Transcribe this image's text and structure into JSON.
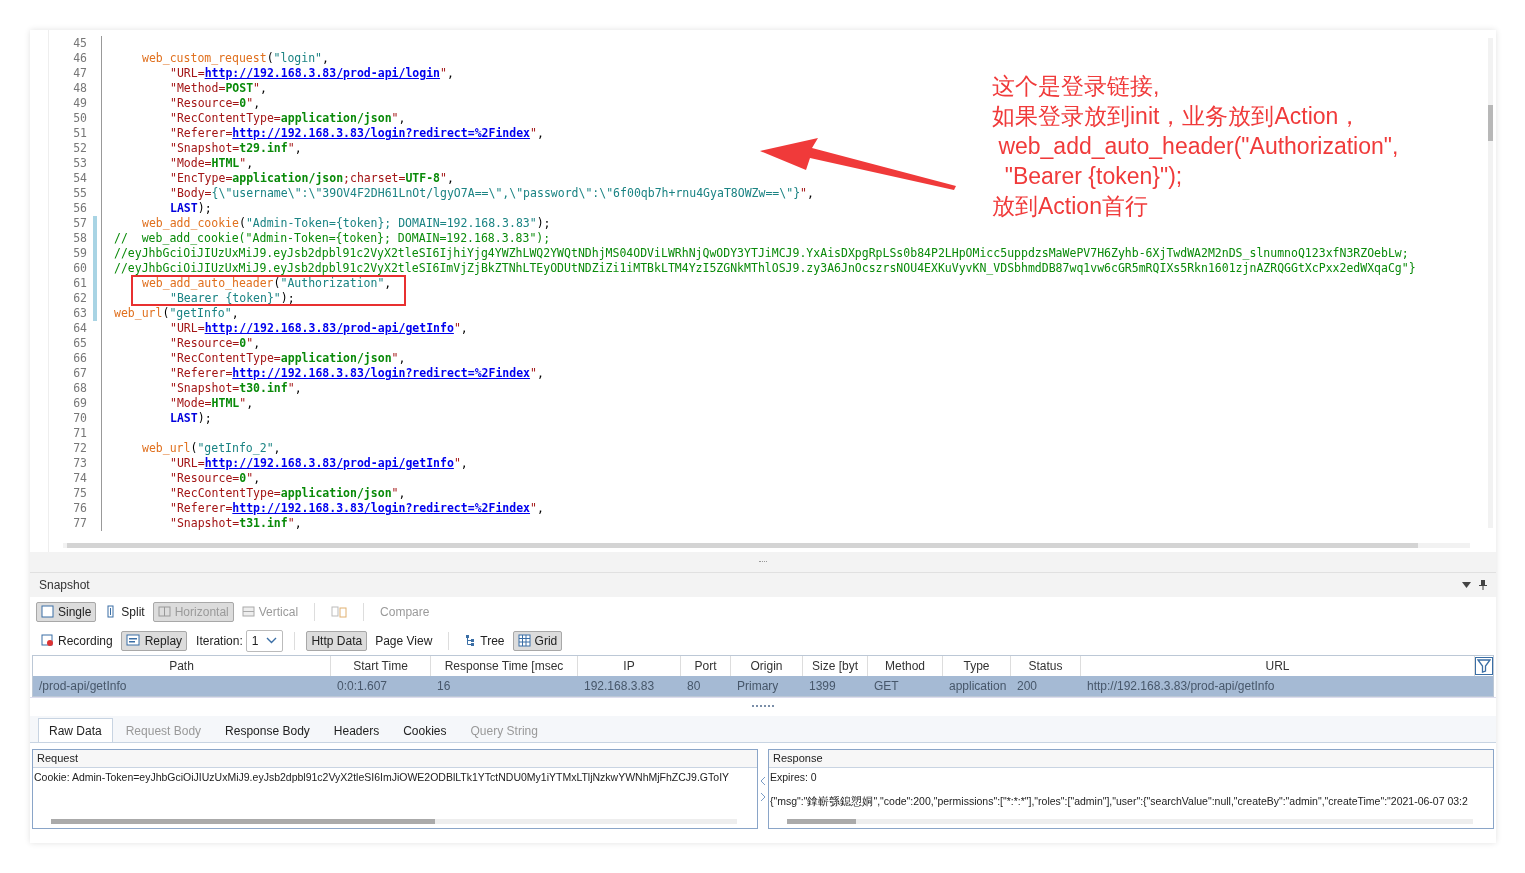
{
  "editor": {
    "lines": [
      {
        "number": "45",
        "changed": false,
        "kind": "blank"
      },
      {
        "number": "46",
        "changed": false,
        "kind": "call",
        "segments": [
          {
            "kind": "fn",
            "text": "web_custom_request"
          },
          {
            "kind": "p",
            "text": "("
          },
          {
            "kind": "str",
            "text": "\"login\""
          },
          {
            "kind": "p",
            "text": ","
          }
        ]
      },
      {
        "number": "47",
        "changed": false,
        "kind": "param",
        "segments": [
          {
            "kind": "key",
            "text": "\"URL="
          },
          {
            "kind": "link",
            "text": "http://192.168.3.83/prod-api/login"
          },
          {
            "kind": "key",
            "text": "\""
          },
          {
            "kind": "p",
            "text": ","
          }
        ]
      },
      {
        "number": "48",
        "changed": false,
        "kind": "param",
        "segments": [
          {
            "kind": "key",
            "text": "\"Method="
          },
          {
            "kind": "val",
            "text": "POST"
          },
          {
            "kind": "key",
            "text": "\""
          },
          {
            "kind": "p",
            "text": ","
          }
        ]
      },
      {
        "number": "49",
        "changed": false,
        "kind": "param",
        "segments": [
          {
            "kind": "key",
            "text": "\"Resource="
          },
          {
            "kind": "val",
            "text": "0"
          },
          {
            "kind": "key",
            "text": "\""
          },
          {
            "kind": "p",
            "text": ","
          }
        ]
      },
      {
        "number": "50",
        "changed": false,
        "kind": "param",
        "segments": [
          {
            "kind": "key",
            "text": "\"RecContentType="
          },
          {
            "kind": "val",
            "text": "application/json"
          },
          {
            "kind": "key",
            "text": "\""
          },
          {
            "kind": "p",
            "text": ","
          }
        ]
      },
      {
        "number": "51",
        "changed": false,
        "kind": "param",
        "segments": [
          {
            "kind": "key",
            "text": "\"Referer="
          },
          {
            "kind": "link",
            "text": "http://192.168.3.83/login?redirect=%2Findex"
          },
          {
            "kind": "key",
            "text": "\""
          },
          {
            "kind": "p",
            "text": ","
          }
        ]
      },
      {
        "number": "52",
        "changed": false,
        "kind": "param",
        "segments": [
          {
            "kind": "key",
            "text": "\"Snapshot="
          },
          {
            "kind": "val",
            "text": "t29.inf"
          },
          {
            "kind": "key",
            "text": "\""
          },
          {
            "kind": "p",
            "text": ","
          }
        ]
      },
      {
        "number": "53",
        "changed": false,
        "kind": "param",
        "segments": [
          {
            "kind": "key",
            "text": "\"Mode="
          },
          {
            "kind": "val",
            "text": "HTML"
          },
          {
            "kind": "key",
            "text": "\""
          },
          {
            "kind": "p",
            "text": ","
          }
        ]
      },
      {
        "number": "54",
        "changed": false,
        "kind": "param",
        "segments": [
          {
            "kind": "key",
            "text": "\"EncType="
          },
          {
            "kind": "val",
            "text": "application/json"
          },
          {
            "kind": "key",
            "text": ";charset="
          },
          {
            "kind": "val",
            "text": "UTF-8"
          },
          {
            "kind": "key",
            "text": "\""
          },
          {
            "kind": "p",
            "text": ","
          }
        ]
      },
      {
        "number": "55",
        "changed": false,
        "kind": "param",
        "segments": [
          {
            "kind": "key",
            "text": "\"Body="
          },
          {
            "kind": "str",
            "text": "{\\\"username\\\":\\\"39OV4F2DH61LnOt/lgyO7A==\\\",\\\"password\\\":\\\"6f00qb7h+rnu4GyaT8OWZw==\\\"}"
          },
          {
            "kind": "key",
            "text": "\""
          },
          {
            "kind": "p",
            "text": ","
          }
        ]
      },
      {
        "number": "56",
        "changed": false,
        "kind": "param",
        "segments": [
          {
            "kind": "kw",
            "text": "LAST"
          },
          {
            "kind": "p",
            "text": ");"
          }
        ]
      },
      {
        "number": "57",
        "changed": true,
        "kind": "call",
        "segments": [
          {
            "kind": "fn",
            "text": "web_add_cookie"
          },
          {
            "kind": "p",
            "text": "("
          },
          {
            "kind": "str",
            "text": "\"Admin-Token={token}; DOMAIN=192.168.3.83\""
          },
          {
            "kind": "p",
            "text": ");"
          }
        ]
      },
      {
        "number": "58",
        "changed": true,
        "kind": "flush",
        "segments": [
          {
            "kind": "cmt",
            "text": "//  web_add_cookie(\"Admin-Token={token}; DOMAIN=192.168.3.83\");"
          }
        ]
      },
      {
        "number": "59",
        "changed": true,
        "kind": "flush",
        "segments": [
          {
            "kind": "cmt",
            "text": "//eyJhbGciOiJIUzUxMiJ9.eyJsb2dpbl91c2VyX2tleSI6IjhiYjg4YWZhLWQ2YWQtNDhjMS04ODViLWRhNjQwODY3YTJiMCJ9.YxAisDXpgRpLSs0b84P2LHpOMicc5uppdzsMaWePV7H6Zyhb-6XjTwdWA2M2nDS_slnumnoQ123xfN3RZOebLw;"
          }
        ]
      },
      {
        "number": "60",
        "changed": true,
        "kind": "flush",
        "segments": [
          {
            "kind": "cmt",
            "text": "//eyJhbGciOiJIUzUxMiJ9.eyJsb2dpbl91c2VyX2tleSI6ImVjZjBkZTNhLTEyODUtNDZiZi1iMTBkLTM4YzI5ZGNkMThlOSJ9.zy3A6JnOcszrsNOU4EXKuVyvKN_VDSbhmdDB87wq1vw6cGR5mRQIXs5Rkn1601zjnAZRQGGtXcPxx2edWXqaCg\"}"
          }
        ]
      },
      {
        "number": "61",
        "changed": true,
        "kind": "call",
        "segments": [
          {
            "kind": "fn",
            "text": "web_add_auto_header"
          },
          {
            "kind": "p",
            "text": "("
          },
          {
            "kind": "str",
            "text": "\"Authorization\""
          },
          {
            "kind": "p",
            "text": ","
          }
        ]
      },
      {
        "number": "62",
        "changed": true,
        "kind": "param",
        "segments": [
          {
            "kind": "str",
            "text": "\"Bearer {token}\""
          },
          {
            "kind": "p",
            "text": ");"
          }
        ]
      },
      {
        "number": "63",
        "changed": true,
        "kind": "flush",
        "segments": [
          {
            "kind": "fn",
            "text": "web_url"
          },
          {
            "kind": "p",
            "text": "("
          },
          {
            "kind": "str",
            "text": "\"getInfo\""
          },
          {
            "kind": "p",
            "text": ","
          }
        ]
      },
      {
        "number": "64",
        "changed": false,
        "kind": "param",
        "segments": [
          {
            "kind": "key",
            "text": "\"URL="
          },
          {
            "kind": "link",
            "text": "http://192.168.3.83/prod-api/getInfo"
          },
          {
            "kind": "key",
            "text": "\""
          },
          {
            "kind": "p",
            "text": ","
          }
        ]
      },
      {
        "number": "65",
        "changed": false,
        "kind": "param",
        "segments": [
          {
            "kind": "key",
            "text": "\"Resource="
          },
          {
            "kind": "val",
            "text": "0"
          },
          {
            "kind": "key",
            "text": "\""
          },
          {
            "kind": "p",
            "text": ","
          }
        ]
      },
      {
        "number": "66",
        "changed": false,
        "kind": "param",
        "segments": [
          {
            "kind": "key",
            "text": "\"RecContentType="
          },
          {
            "kind": "val",
            "text": "application/json"
          },
          {
            "kind": "key",
            "text": "\""
          },
          {
            "kind": "p",
            "text": ","
          }
        ]
      },
      {
        "number": "67",
        "changed": false,
        "kind": "param",
        "segments": [
          {
            "kind": "key",
            "text": "\"Referer="
          },
          {
            "kind": "link",
            "text": "http://192.168.3.83/login?redirect=%2Findex"
          },
          {
            "kind": "key",
            "text": "\""
          },
          {
            "kind": "p",
            "text": ","
          }
        ]
      },
      {
        "number": "68",
        "changed": false,
        "kind": "param",
        "segments": [
          {
            "kind": "key",
            "text": "\"Snapshot="
          },
          {
            "kind": "val",
            "text": "t30.inf"
          },
          {
            "kind": "key",
            "text": "\""
          },
          {
            "kind": "p",
            "text": ","
          }
        ]
      },
      {
        "number": "69",
        "changed": false,
        "kind": "param",
        "segments": [
          {
            "kind": "key",
            "text": "\"Mode="
          },
          {
            "kind": "val",
            "text": "HTML"
          },
          {
            "kind": "key",
            "text": "\""
          },
          {
            "kind": "p",
            "text": ","
          }
        ]
      },
      {
        "number": "70",
        "changed": false,
        "kind": "param",
        "segments": [
          {
            "kind": "kw",
            "text": "LAST"
          },
          {
            "kind": "p",
            "text": ");"
          }
        ]
      },
      {
        "number": "71",
        "changed": false,
        "kind": "blank"
      },
      {
        "number": "72",
        "changed": false,
        "kind": "call",
        "segments": [
          {
            "kind": "fn",
            "text": "web_url"
          },
          {
            "kind": "p",
            "text": "("
          },
          {
            "kind": "str",
            "text": "\"getInfo_2\""
          },
          {
            "kind": "p",
            "text": ","
          }
        ]
      },
      {
        "number": "73",
        "changed": false,
        "kind": "param",
        "segments": [
          {
            "kind": "key",
            "text": "\"URL="
          },
          {
            "kind": "link",
            "text": "http://192.168.3.83/prod-api/getInfo"
          },
          {
            "kind": "key",
            "text": "\""
          },
          {
            "kind": "p",
            "text": ","
          }
        ]
      },
      {
        "number": "74",
        "changed": false,
        "kind": "param",
        "segments": [
          {
            "kind": "key",
            "text": "\"Resource="
          },
          {
            "kind": "val",
            "text": "0"
          },
          {
            "kind": "key",
            "text": "\""
          },
          {
            "kind": "p",
            "text": ","
          }
        ]
      },
      {
        "number": "75",
        "changed": false,
        "kind": "param",
        "segments": [
          {
            "kind": "key",
            "text": "\"RecContentType="
          },
          {
            "kind": "val",
            "text": "application/json"
          },
          {
            "kind": "key",
            "text": "\""
          },
          {
            "kind": "p",
            "text": ","
          }
        ]
      },
      {
        "number": "76",
        "changed": false,
        "kind": "param",
        "segments": [
          {
            "kind": "key",
            "text": "\"Referer="
          },
          {
            "kind": "link",
            "text": "http://192.168.3.83/login?redirect=%2Findex"
          },
          {
            "kind": "key",
            "text": "\""
          },
          {
            "kind": "p",
            "text": ","
          }
        ]
      },
      {
        "number": "77",
        "changed": false,
        "kind": "param",
        "segments": [
          {
            "kind": "key",
            "text": "\"Snapshot="
          },
          {
            "kind": "val",
            "text": "t31.inf"
          },
          {
            "kind": "key",
            "text": "\""
          },
          {
            "kind": "p",
            "text": ","
          }
        ]
      }
    ]
  },
  "annotation": {
    "lines": [
      "这个是登录链接,",
      "如果登录放到init，业务放到Action，",
      " web_add_auto_header(\"Authorization\",",
      "  \"Bearer {token}\");",
      "放到Action首行"
    ]
  },
  "snapshot_panel": {
    "title": "Snapshot",
    "layout_buttons": [
      {
        "label": "Single",
        "selected": true,
        "disabled": false
      },
      {
        "label": "Split",
        "selected": false,
        "disabled": false
      },
      {
        "label": "Horizontal",
        "selected": true,
        "disabled": true
      },
      {
        "label": "Vertical",
        "selected": false,
        "disabled": true
      }
    ],
    "sync_button": {
      "disabled": true
    },
    "compare_button": {
      "label": "Compare",
      "disabled": true
    },
    "mode_buttons": [
      {
        "label": "Recording",
        "selected": false
      },
      {
        "label": "Replay",
        "selected": true
      }
    ],
    "iteration": {
      "label": "Iteration:",
      "value": "1"
    },
    "data_buttons": [
      {
        "label": "Http Data",
        "selected": true
      },
      {
        "label": "Page View",
        "selected": false
      }
    ],
    "view_buttons": [
      {
        "label": "Tree",
        "selected": false
      },
      {
        "label": "Grid",
        "selected": true
      }
    ],
    "table": {
      "columns": [
        "Path",
        "Start Time",
        "Response Time [msec",
        "IP",
        "Port",
        "Origin",
        "Size [byt",
        "Method",
        "Type",
        "Status",
        "URL"
      ],
      "rows": [
        {
          "selected": true,
          "cells": [
            "/prod-api/getInfo",
            "0:0:1.607",
            "16",
            "192.168.3.83",
            "80",
            "Primary",
            "1399",
            "GET",
            "application",
            "200",
            "http://192.168.3.83/prod-api/getInfo"
          ]
        }
      ]
    },
    "detail_tabs": [
      {
        "label": "Raw Data",
        "selected": true,
        "disabled": false
      },
      {
        "label": "Request Body",
        "selected": false,
        "disabled": true
      },
      {
        "label": "Response Body",
        "selected": false,
        "disabled": false
      },
      {
        "label": "Headers",
        "selected": false,
        "disabled": false
      },
      {
        "label": "Cookies",
        "selected": false,
        "disabled": false
      },
      {
        "label": "Query String",
        "selected": false,
        "disabled": true
      }
    ],
    "request": {
      "title": "Request",
      "lines": [
        "Cookie: Admin-Token=eyJhbGciOiJIUzUxMiJ9.eyJsb2dpbl91c2VyX2tleSI6ImJiOWE2ODBlLTk1YTctNDU0My1iYTMxLTljNzkwYWNhMjFhZCJ9.GToIY"
      ]
    },
    "response": {
      "title": "Response",
      "lines": [
        "Expires: 0",
        "{\"msg\":\"鎿嶄綔鎴愬姛\",\"code\":200,\"permissions\":[\"*:*:*\"],\"roles\":[\"admin\"],\"user\":{\"searchValue\":null,\"createBy\":\"admin\",\"createTime\":\"2021-06-07 03:2"
      ]
    }
  }
}
